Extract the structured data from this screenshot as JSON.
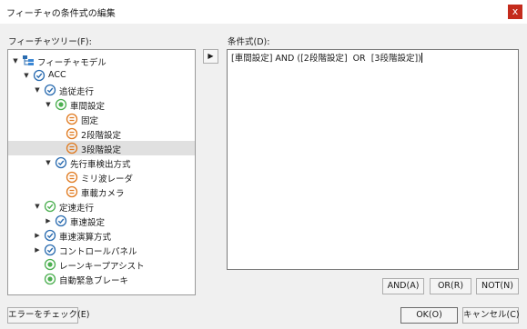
{
  "window": {
    "title": "フィーチャの条件式の編集",
    "close_glyph": "x"
  },
  "tree": {
    "label": "フィーチャツリー(F):",
    "nodes": [
      {
        "label": "フィーチャモデル",
        "icon": "feature-model-icon",
        "toggle": "expanded"
      },
      {
        "label": "ACC",
        "icon": "mandatory-check-icon",
        "toggle": "expanded"
      },
      {
        "label": "追従走行",
        "icon": "mandatory-check-icon",
        "toggle": "expanded"
      },
      {
        "label": "車間設定",
        "icon": "alternative-group-icon",
        "toggle": "expanded"
      },
      {
        "label": "固定",
        "icon": "alternative-option-icon",
        "toggle": "none"
      },
      {
        "label": "2段階設定",
        "icon": "alternative-option-icon",
        "toggle": "none"
      },
      {
        "label": "3段階設定",
        "icon": "alternative-option-icon",
        "toggle": "none",
        "selected": true
      },
      {
        "label": "先行車検出方式",
        "icon": "mandatory-check-icon",
        "toggle": "expanded"
      },
      {
        "label": "ミリ波レーダ",
        "icon": "alternative-option-icon",
        "toggle": "none"
      },
      {
        "label": "車載カメラ",
        "icon": "alternative-option-icon",
        "toggle": "none"
      },
      {
        "label": "定速走行",
        "icon": "optional-check-icon",
        "toggle": "expanded"
      },
      {
        "label": "車速設定",
        "icon": "mandatory-check-icon",
        "toggle": "collapsed"
      },
      {
        "label": "車速演算方式",
        "icon": "mandatory-check-icon",
        "toggle": "collapsed"
      },
      {
        "label": "コントロールパネル",
        "icon": "mandatory-check-icon",
        "toggle": "collapsed"
      },
      {
        "label": "レーンキープアシスト",
        "icon": "optional-dot-icon",
        "toggle": "none"
      },
      {
        "label": "自動緊急ブレーキ",
        "icon": "optional-dot-icon",
        "toggle": "none"
      }
    ]
  },
  "insert_button": {
    "glyph": "▶"
  },
  "expression": {
    "label": "条件式(D):",
    "value": "[車間設定] AND ([2段階設定]  OR  [3段階設定])"
  },
  "operators": {
    "and": "AND(A)",
    "or": "OR(R)",
    "not": "NOT(N)"
  },
  "footer": {
    "check_errors": "エラーをチェック(E)",
    "ok": "OK(O)",
    "cancel": "キャンセル(C)"
  },
  "colors": {
    "check_green": "#4caf50",
    "check_blue": "#2b6cb0",
    "alternative_orange": "#e07a1f",
    "selection": "#e0e0e0",
    "close_red": "#c42b1c"
  }
}
